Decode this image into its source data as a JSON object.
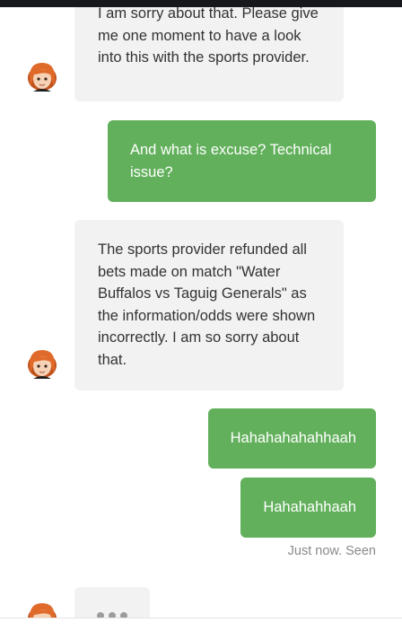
{
  "messages": [
    {
      "sender": "agent",
      "text": "I am sorry about that. Please give me one moment to have a look into this with the sports provider."
    },
    {
      "sender": "user",
      "text": "And what is excuse? Technical issue?"
    },
    {
      "sender": "agent",
      "text": "The sports provider refunded all bets made on match \"Water Buffalos vs Taguig Generals\" as the information/odds were shown incorrectly. I am so sorry about that."
    },
    {
      "sender": "user",
      "text": "Hahahahahahhaah"
    },
    {
      "sender": "user",
      "text": "Hahahahhaah"
    }
  ],
  "status": "Just now. Seen",
  "colors": {
    "agent_bubble": "#f2f2f2",
    "user_bubble": "#62b05c",
    "status_text": "#8a8a8a"
  },
  "icons": {
    "agent_avatar": "support-agent-avatar-icon",
    "typing": "typing-dots-icon"
  }
}
